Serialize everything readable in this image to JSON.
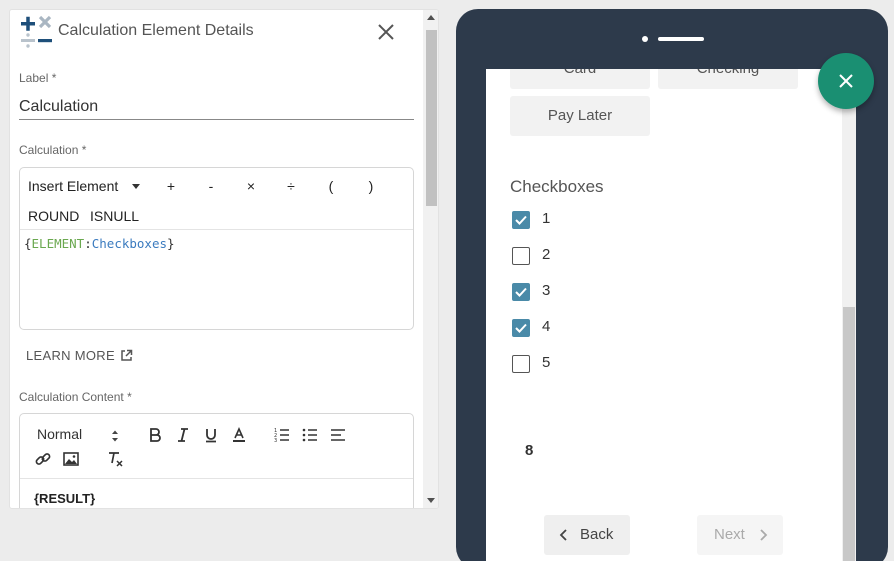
{
  "panel": {
    "title": "Calculation Element Details",
    "label_field": {
      "label": "Label *",
      "value": "Calculation"
    },
    "calculation_field": {
      "label": "Calculation *",
      "insert_element": "Insert Element",
      "operators": [
        "+",
        "-",
        "×",
        "÷",
        "(",
        ")"
      ],
      "functions": [
        "ROUND",
        "ISNULL"
      ],
      "formula": {
        "open": "{",
        "keyword": "ELEMENT",
        "sep": ":",
        "name": "Checkboxes",
        "close": "}"
      }
    },
    "learn_more": "LEARN MORE",
    "content_field": {
      "label": "Calculation Content *",
      "format_select": "Normal",
      "body": "{RESULT}"
    }
  },
  "preview": {
    "buttons": {
      "card": "Card",
      "checking": "Checking",
      "pay_later": "Pay Later"
    },
    "group_label": "Checkboxes",
    "checkboxes": [
      {
        "label": "1",
        "checked": true
      },
      {
        "label": "2",
        "checked": false
      },
      {
        "label": "3",
        "checked": true
      },
      {
        "label": "4",
        "checked": true
      },
      {
        "label": "5",
        "checked": false
      }
    ],
    "result": "8",
    "back": "Back",
    "next": "Next"
  },
  "colors": {
    "accent": "#1a8f72",
    "checkbox": "#4a8aa8",
    "phone_frame": "#2d3a4b"
  },
  "icons": [
    "calculator-icon",
    "close-icon",
    "external-link-icon",
    "bold-icon",
    "italic-icon",
    "underline-icon",
    "text-color-icon",
    "ordered-list-icon",
    "bullet-list-icon",
    "align-icon",
    "link-icon",
    "image-icon",
    "clear-format-icon",
    "chevron-left-icon",
    "chevron-right-icon",
    "fab-close-icon"
  ]
}
